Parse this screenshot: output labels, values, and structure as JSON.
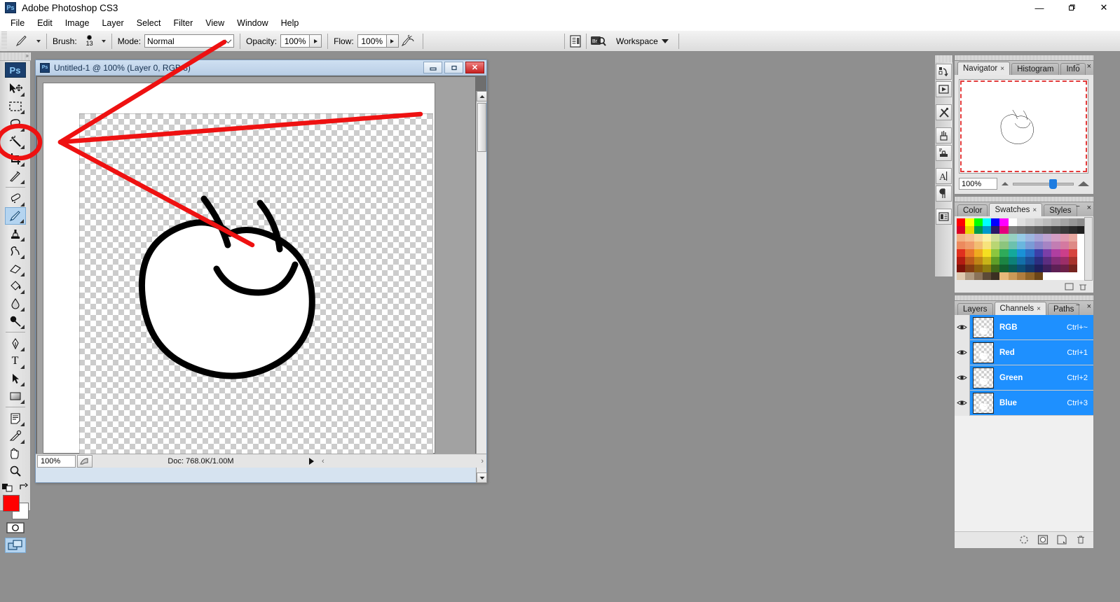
{
  "window": {
    "title": "Adobe Photoshop CS3",
    "app_icon": "Ps",
    "minimize": "—",
    "maximize": "❐",
    "close": "✕"
  },
  "menubar": {
    "items": [
      "File",
      "Edit",
      "Image",
      "Layer",
      "Select",
      "Filter",
      "View",
      "Window",
      "Help"
    ]
  },
  "options_bar": {
    "brush_label": "Brush:",
    "brush_size": "13",
    "mode_label": "Mode:",
    "mode_value": "Normal",
    "opacity_label": "Opacity:",
    "opacity_value": "100%",
    "flow_label": "Flow:",
    "flow_value": "100%",
    "airbrush_icon": "airbrush-icon",
    "palettes_icon": "palette-well-icon",
    "bridge_icon": "bridge-icon",
    "bridge_label": "Br",
    "workspace_label": "Workspace"
  },
  "toolbox": {
    "logo": "Ps",
    "tools": [
      {
        "name": "move-tool",
        "icon": "arrow-move-icon",
        "selected": false
      },
      {
        "name": "marquee-tool",
        "icon": "rectangular-marquee-icon",
        "selected": false
      },
      {
        "name": "lasso-tool",
        "icon": "lasso-icon",
        "selected": false
      },
      {
        "name": "magic-wand-tool",
        "icon": "magic-wand-icon",
        "selected": false
      },
      {
        "name": "crop-tool",
        "icon": "crop-icon",
        "selected": false
      },
      {
        "name": "slice-tool",
        "icon": "slice-knife-icon",
        "selected": false
      },
      {
        "name": "healing-brush-tool",
        "icon": "healing-brush-icon",
        "selected": false
      },
      {
        "name": "brush-tool",
        "icon": "paintbrush-icon",
        "selected": true
      },
      {
        "name": "clone-stamp-tool",
        "icon": "clone-stamp-icon",
        "selected": false
      },
      {
        "name": "history-brush-tool",
        "icon": "history-brush-icon",
        "selected": false
      },
      {
        "name": "eraser-tool",
        "icon": "eraser-icon",
        "selected": false
      },
      {
        "name": "gradient-tool",
        "icon": "paint-bucket-icon",
        "selected": false
      },
      {
        "name": "blur-tool",
        "icon": "water-drop-icon",
        "selected": false
      },
      {
        "name": "dodge-tool",
        "icon": "dodge-icon",
        "selected": false
      },
      {
        "name": "pen-tool",
        "icon": "pen-nib-icon",
        "selected": false
      },
      {
        "name": "type-tool",
        "icon": "text-t-icon",
        "selected": false
      },
      {
        "name": "path-selection-tool",
        "icon": "black-arrow-icon",
        "selected": false
      },
      {
        "name": "shape-tool",
        "icon": "rectangle-shape-icon",
        "selected": false
      },
      {
        "name": "notes-tool",
        "icon": "notes-icon",
        "selected": false
      },
      {
        "name": "eyedropper-tool",
        "icon": "eyedropper-icon",
        "selected": false
      },
      {
        "name": "hand-tool",
        "icon": "hand-icon",
        "selected": false
      },
      {
        "name": "zoom-tool",
        "icon": "magnifier-icon",
        "selected": false
      }
    ],
    "foreground_color": "#ff0000",
    "background_color": "#ffffff",
    "quick_mask_icon": "quick-mask-icon",
    "screen_mode_icon": "screen-mode-icon"
  },
  "document": {
    "icon": "Ps",
    "title": "Untitled-1 @ 100% (Layer 0, RGB/8)",
    "minimize": "—",
    "restore": "▣",
    "close": "✕",
    "status_zoom": "100%",
    "status_doc": "Doc: 768.0K/1.00M"
  },
  "dock_column": {
    "buttons": [
      {
        "name": "history-panel-icon",
        "label": "history-icon"
      },
      {
        "name": "actions-panel-icon",
        "label": "actions-play-icon"
      },
      {
        "name": "tool-presets-panel-icon",
        "label": "tools-crossed-icon"
      },
      {
        "name": "brushes-panel-icon",
        "label": "brushes-jar-icon"
      },
      {
        "name": "clone-source-panel-icon",
        "label": "clone-source-icon"
      },
      {
        "name": "character-panel-icon",
        "label": "character-A-icon"
      },
      {
        "name": "paragraph-panel-icon",
        "label": "paragraph-pilcrow-icon"
      },
      {
        "name": "layer-comps-panel-icon",
        "label": "layer-comps-icon"
      }
    ]
  },
  "navigator_panel": {
    "tabs": [
      {
        "label": "Navigator",
        "active": true,
        "closable": true
      },
      {
        "label": "Histogram",
        "active": false,
        "closable": false
      },
      {
        "label": "Info",
        "active": false,
        "closable": false
      }
    ],
    "zoom_value": "100%",
    "zoom_out_icon": "zoom-out-small-icon",
    "zoom_in_icon": "zoom-in-large-icon"
  },
  "color_panel": {
    "tabs": [
      {
        "label": "Color",
        "active": false,
        "closable": false
      },
      {
        "label": "Swatches",
        "active": true,
        "closable": true
      },
      {
        "label": "Styles",
        "active": false,
        "closable": false
      }
    ],
    "swatch_rows": [
      [
        "#ff0000",
        "#ffff00",
        "#00ff00",
        "#00ffff",
        "#0000ff",
        "#ff00ff",
        "#ffffff",
        "#e0e0e0",
        "#d4d4d4",
        "#c8c8c8",
        "#bcbcbc",
        "#b0b0b0",
        "#a4a4a4",
        "#989898",
        "#8c8c8c"
      ],
      [
        "#d90026",
        "#e8d800",
        "#00994d",
        "#0099cc",
        "#2b1a66",
        "#e6007e",
        "#808080",
        "#747474",
        "#686868",
        "#5c5c5c",
        "#505050",
        "#444444",
        "#383838",
        "#2c2c2c",
        "#202020"
      ],
      [
        "#f2b184",
        "#f5bf8f",
        "#f7d79c",
        "#faf0a5",
        "#cfe09a",
        "#a8d4a0",
        "#96d1c2",
        "#96cbe6",
        "#9db6e0",
        "#a8a3d6",
        "#bfa3d1",
        "#d49ec4",
        "#e09bb0",
        "#e8a8a0",
        "#ffffff"
      ],
      [
        "#ec8a5e",
        "#ef9b6b",
        "#f2bd72",
        "#f7e37c",
        "#b9d673",
        "#8cc57d",
        "#6cc1ad",
        "#6ab6de",
        "#7a9bd6",
        "#8a84c9",
        "#a684c4",
        "#c27db3",
        "#d479a0",
        "#de8a86",
        "#ffffff"
      ],
      [
        "#e0301e",
        "#e8762a",
        "#efab1f",
        "#f5e021",
        "#8cc63f",
        "#2fab5a",
        "#14a89b",
        "#1a91d6",
        "#2a6fc4",
        "#3c3fa8",
        "#7b3fa8",
        "#b03fa0",
        "#cc3f8a",
        "#d6453f",
        "#ffffff"
      ],
      [
        "#b21c12",
        "#bb5a1b",
        "#c08516",
        "#c9b418",
        "#5f9e28",
        "#1c8543",
        "#0d8178",
        "#136fa8",
        "#1d4f96",
        "#2c2e80",
        "#5c2e80",
        "#862e78",
        "#9c2e68",
        "#a8332c",
        "#ffffff"
      ],
      [
        "#7d1209",
        "#853c12",
        "#8a5d0f",
        "#8f7d10",
        "#40691a",
        "#13602f",
        "#095a54",
        "#0c4e75",
        "#133769",
        "#1e1f5c",
        "#40205c",
        "#5e2055",
        "#6d2049",
        "#76241f",
        "#ffffff"
      ],
      [
        "#e0cbb0",
        "#b09a80",
        "#8a7258",
        "#5c4a36",
        "#3b2f22",
        "#e8b87a",
        "#cc9a58",
        "#b07d3e",
        "#8f6328",
        "#6b4518",
        "#ffffff",
        "#ffffff",
        "#ffffff",
        "#ffffff",
        "#ffffff"
      ]
    ]
  },
  "channels_panel": {
    "tabs": [
      {
        "label": "Layers",
        "active": false,
        "closable": false
      },
      {
        "label": "Channels",
        "active": true,
        "closable": true
      },
      {
        "label": "Paths",
        "active": false,
        "closable": false
      }
    ],
    "rows": [
      {
        "name": "RGB",
        "shortcut": "Ctrl+~",
        "visible": true,
        "selected": true
      },
      {
        "name": "Red",
        "shortcut": "Ctrl+1",
        "visible": true,
        "selected": true
      },
      {
        "name": "Green",
        "shortcut": "Ctrl+2",
        "visible": true,
        "selected": true
      },
      {
        "name": "Blue",
        "shortcut": "Ctrl+3",
        "visible": true,
        "selected": true
      }
    ],
    "footer_icons": [
      {
        "name": "load-channel-as-selection-icon"
      },
      {
        "name": "save-selection-as-channel-icon"
      },
      {
        "name": "create-new-channel-icon"
      },
      {
        "name": "delete-channel-icon"
      }
    ]
  },
  "annotation": {
    "color": "#ee1111",
    "description": "red-arrow-pointing-to-magic-wand-tool"
  }
}
